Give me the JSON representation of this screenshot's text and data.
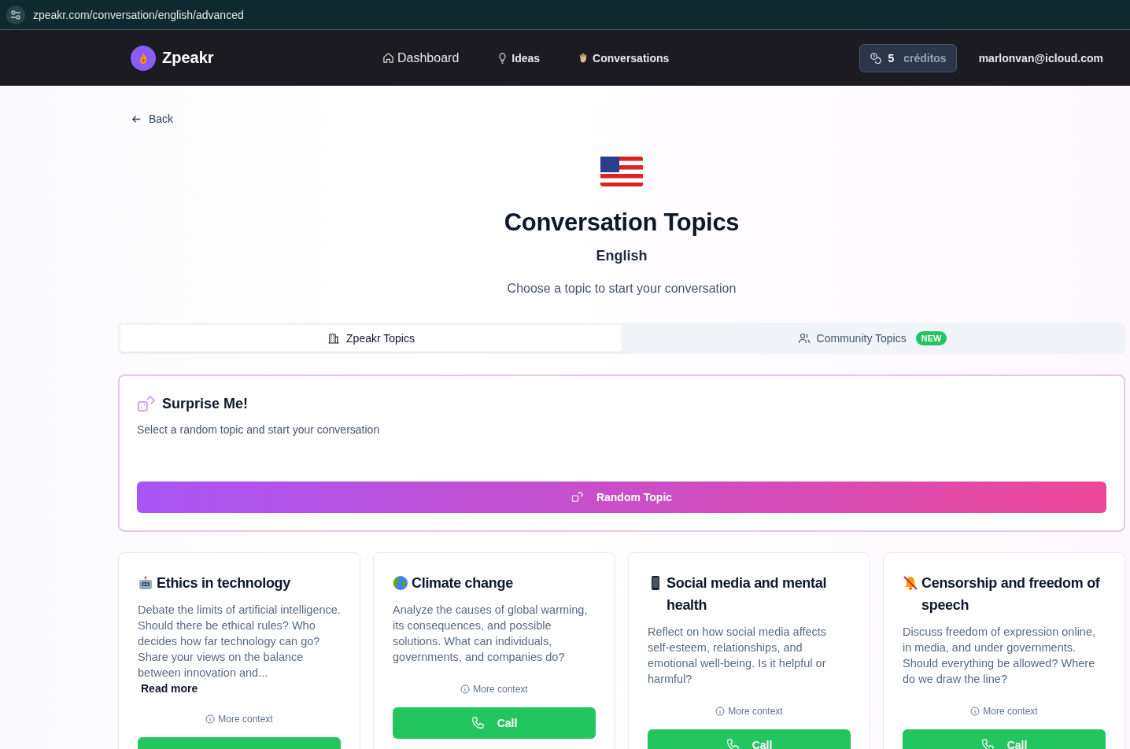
{
  "browser": {
    "url": "zpeakr.com/conversation/english/advanced"
  },
  "nav": {
    "brand": "Zpeakr",
    "links": [
      {
        "label": "Dashboard"
      },
      {
        "label": "Ideas"
      },
      {
        "label": "Conversations"
      }
    ],
    "credits": {
      "count": "5",
      "label": "créditos"
    },
    "user": "marlonvan@icloud.com"
  },
  "back": "Back",
  "header": {
    "title": "Conversation Topics",
    "language": "English",
    "subtitle": "Choose a topic to start your conversation"
  },
  "tabs": [
    {
      "label": "Zpeakr Topics",
      "selected": true
    },
    {
      "label": "Community Topics",
      "selected": false,
      "badge": "NEW"
    }
  ],
  "surprise": {
    "title": "Surprise Me!",
    "text": "Select a random topic and start your conversation",
    "button": "Random Topic"
  },
  "topics": [
    {
      "title": "Ethics in technology",
      "text": "Debate the limits of artificial intelligence. Should there be ethical rules? Who decides how far technology can go? Share your views on the balance between innovation and...",
      "read_more": "Read more",
      "context": "More context"
    },
    {
      "title": "Climate change",
      "text": "Analyze the causes of global warming, its consequences, and possible solutions. What can individuals, governments, and companies do?",
      "context": "More context",
      "call": "Call"
    },
    {
      "title": "Social media and mental health",
      "text": "Reflect on how social media affects self-esteem, relationships, and emotional well-being. Is it helpful or harmful?",
      "context": "More context",
      "call": "Call"
    },
    {
      "title": "Censorship and freedom of speech",
      "text": "Discuss freedom of expression online, in media, and under governments. Should everything be allowed? Where do we draw the line?",
      "context": "More context",
      "call": "Call"
    }
  ]
}
